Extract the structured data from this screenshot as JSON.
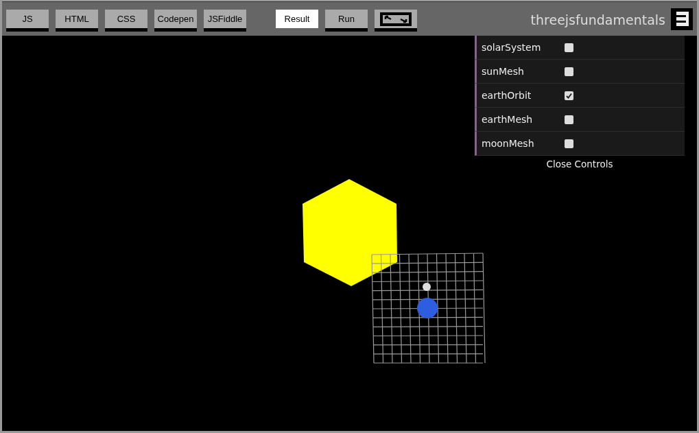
{
  "toolbar": {
    "buttons": [
      {
        "label": "JS",
        "selected": false
      },
      {
        "label": "HTML",
        "selected": false
      },
      {
        "label": "CSS",
        "selected": false
      },
      {
        "label": "Codepen",
        "selected": false
      },
      {
        "label": "JSFiddle",
        "selected": false
      },
      {
        "label": "Result",
        "selected": true
      },
      {
        "label": "Run",
        "selected": false
      }
    ],
    "brand": "threejsfundamentals"
  },
  "controls": {
    "items": [
      {
        "label": "solarSystem",
        "checked": false
      },
      {
        "label": "sunMesh",
        "checked": false
      },
      {
        "label": "earthOrbit",
        "checked": true
      },
      {
        "label": "earthMesh",
        "checked": false
      },
      {
        "label": "moonMesh",
        "checked": false
      }
    ],
    "close": "Close Controls"
  }
}
